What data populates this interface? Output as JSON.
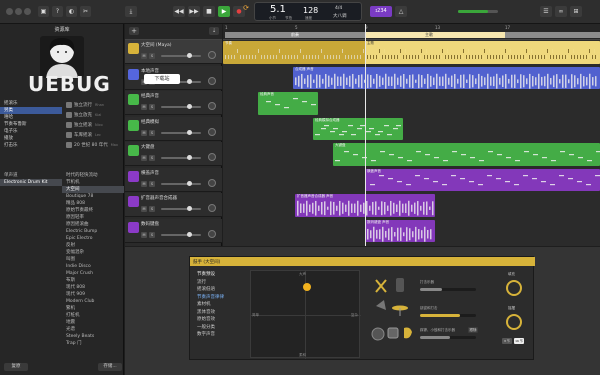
{
  "toolbar": {
    "lcd": {
      "bar_beat": "5.1",
      "bar_label": "小节",
      "beat_label": "节拍",
      "tempo": "128",
      "tempo_label": "速度",
      "signature": "4/4",
      "key": "大八调"
    },
    "badge": "ɪ234",
    "accent": "#f2a93b"
  },
  "library": {
    "title": "资源库",
    "categories": [
      "摇滚乐",
      "另类",
      "嘻哈",
      "节奏布鲁斯",
      "电子乐",
      "播放",
      "打击乐"
    ],
    "selected_category": "另类",
    "players": [
      {
        "name": "独立流行",
        "sub": "Rhan"
      },
      {
        "name": "独立放克",
        "sub": "Kial"
      },
      {
        "name": "独立摇滚",
        "sub": "Nico"
      },
      {
        "name": "车库摇滚",
        "sub": "Lec"
      },
      {
        "name": "20 世纪 80 年代",
        "sub": "Max"
      }
    ],
    "kits": [
      "单声道",
      "Electronic Drum Kit"
    ],
    "patches": [
      "时代的轻快流动",
      "节机机",
      "大空间",
      "Boutique 78",
      "精品 808",
      "原始节奏最终",
      "原因轻率",
      "原因摇滚曲",
      "Electric Bump",
      "Epic Electro",
      "反射",
      "变幅混杂",
      "叫图",
      "Indie Disco",
      "Major Crush",
      "布斯",
      "现代 808",
      "现代 909",
      "Modern Club",
      "繁机",
      "打桩机",
      "地震",
      "光谱",
      "Steely Beats",
      "Trap 门"
    ],
    "selected_patch": "大空间",
    "revert_button": "复原",
    "save_button": "存储..."
  },
  "watermark": {
    "logo": "UEBUG",
    "sub": "下载站"
  },
  "tracks": [
    {
      "name": "大空间 (Maya)",
      "color": "#d7b33a"
    },
    {
      "name": "本地声音",
      "color": "#5566dd"
    },
    {
      "name": "经典声音",
      "color": "#47b849"
    },
    {
      "name": "经典模拟",
      "color": "#47b849"
    },
    {
      "name": "大键盘",
      "color": "#47b849"
    },
    {
      "name": "横盖声音",
      "color": "#8b3ac7"
    },
    {
      "name": "扩音器声音合成器",
      "color": "#8b3ac7"
    },
    {
      "name": "数码键盘",
      "color": "#8b3ac7"
    }
  ],
  "ruler": {
    "markers": [
      "前奏",
      "主歌"
    ],
    "numbers": [
      "1",
      "5",
      "9",
      "13",
      "17"
    ]
  },
  "regions": [
    {
      "label": "节奏",
      "track": 0
    },
    {
      "label": "主歌",
      "track": 0
    },
    {
      "label": "合成器 声音",
      "track": 1
    },
    {
      "label": "经典声音",
      "track": 2
    },
    {
      "label": "经典模拟合成器",
      "track": 3
    },
    {
      "label": "大键盘",
      "track": 4
    },
    {
      "label": "横盖声音",
      "track": 5
    },
    {
      "label": "扩音器声音合成器 声音",
      "track": 6
    },
    {
      "label": "数码键盘 声音",
      "track": 7
    }
  ],
  "drummer": {
    "title": "鼓手 (大空间)",
    "preset_header": "节奏预设",
    "presets": [
      "流行",
      "摇滚低语",
      "节奏声音律律",
      "素材机",
      "黑体音效",
      "原始音效",
      "一般分类",
      "数字声音"
    ],
    "selected_preset": "节奏声音律律",
    "pad_labels": {
      "loud": "大声",
      "soft": "柔和",
      "simple": "简单",
      "complex": "复杂"
    },
    "percussion": {
      "label1": "打击乐器",
      "label2": "铙钹和打击"
    },
    "kit_label": "踩镲、小鼓和打击乐器",
    "follow_label": "跟随",
    "fills_label": "填充",
    "swing_label": "摇摆",
    "toggle1": "8 节",
    "toggle2": "16 节"
  }
}
